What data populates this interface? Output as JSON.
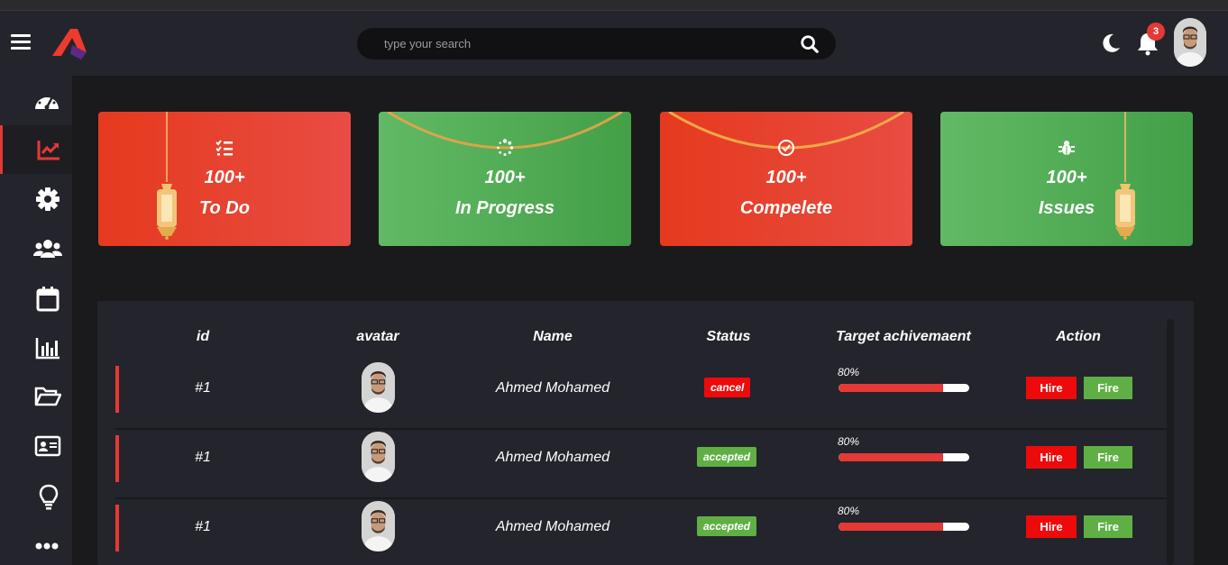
{
  "header": {
    "search_placeholder": "type your search",
    "notification_count": "3",
    "icons": [
      "menu-icon",
      "app-logo",
      "search-icon",
      "moon-icon",
      "bell-icon"
    ]
  },
  "sidebar": {
    "items": [
      {
        "icon": "dashboard-icon",
        "active": false
      },
      {
        "icon": "chart-line-icon",
        "active": true
      },
      {
        "icon": "gear-icon",
        "active": false
      },
      {
        "icon": "users-icon",
        "active": false
      },
      {
        "icon": "calendar-icon",
        "active": false
      },
      {
        "icon": "bar-chart-icon",
        "active": false
      },
      {
        "icon": "folder-open-icon",
        "active": false
      },
      {
        "icon": "id-card-icon",
        "active": false
      },
      {
        "icon": "lightbulb-icon",
        "active": false
      },
      {
        "icon": "more-icon",
        "active": false
      }
    ]
  },
  "cards": [
    {
      "count": "100+",
      "label": "To Do",
      "icon": "checklist-icon",
      "color": "#e53a1e"
    },
    {
      "count": "100+",
      "label": "In Progress",
      "icon": "spinner-icon",
      "color": "#4caf50"
    },
    {
      "count": "100+",
      "label": "Compelete",
      "icon": "check-circle-icon",
      "color": "#e53a1e"
    },
    {
      "count": "100+",
      "label": "Issues",
      "icon": "bug-icon",
      "color": "#4caf50"
    }
  ],
  "table": {
    "headers": {
      "id": "id",
      "avatar": "avatar",
      "name": "Name",
      "status": "Status",
      "target": "Target achivemaent",
      "action": "Action"
    },
    "rows": [
      {
        "id": "#1",
        "name": "Ahmed Mohamed",
        "status": "cancel",
        "target": "80%",
        "progress": 0.8,
        "hire": "Hire",
        "fire": "Fire"
      },
      {
        "id": "#1",
        "name": "Ahmed Mohamed",
        "status": "accepted",
        "target": "80%",
        "progress": 0.8,
        "hire": "Hire",
        "fire": "Fire"
      },
      {
        "id": "#1",
        "name": "Ahmed Mohamed",
        "status": "accepted",
        "target": "80%",
        "progress": 0.8,
        "hire": "Hire",
        "fire": "Fire"
      }
    ]
  },
  "colors": {
    "accent": "#e53935",
    "success": "#5faf45",
    "danger": "#ee0a0a",
    "panel": "#24242c",
    "background": "#1a1a1c"
  }
}
